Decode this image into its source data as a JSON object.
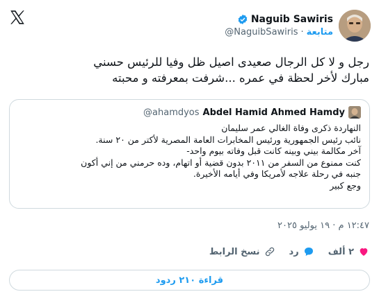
{
  "author": {
    "name": "Naguib Sawiris",
    "handle": "@NaguibSawiris",
    "follow_label": "متابعة"
  },
  "tweet": {
    "lines": [
      "رجل و لا كل الرجال صعيدى اصيل ظل وفيا للرئيس حسني",
      "مبارك لأخر لحظة في عمره ...شرفت بمعرفته و محبته"
    ]
  },
  "quote": {
    "name": "Abdel Hamid Ahmed Hamdy",
    "handle": "@ahamdyos",
    "lines": [
      "النهاردة ذكرى وفاة الغالي عمر سليمان",
      "نائب رئيس الجمهورية ورئيس المخابرات العامة المصرية لأكتر من ٢٠ سنة.",
      "آخر مكالمة بيني وبينه كانت قبل وفاته بيوم واحد-",
      "كنت ممنوع من السفر من ٢٠١١ بدون قضية أو اتهام، وده حرمني من إني أكون",
      "جنبه في رحلة علاجه لأمريكا وفي أيامه الأخيرة.",
      "وجع كبير"
    ]
  },
  "timestamp": "١٢:٤٧ م · ١٩ يوليو ٢٠٢٥",
  "actions": {
    "likes": "٢ ألف",
    "reply": "رد",
    "copy_link": "نسخ الرابط"
  },
  "read_replies": "قراءة ٢١٠ ردود",
  "colors": {
    "accent": "#1d9bf0",
    "like": "#f91880",
    "border": "#cfd9de",
    "muted": "#536471"
  }
}
